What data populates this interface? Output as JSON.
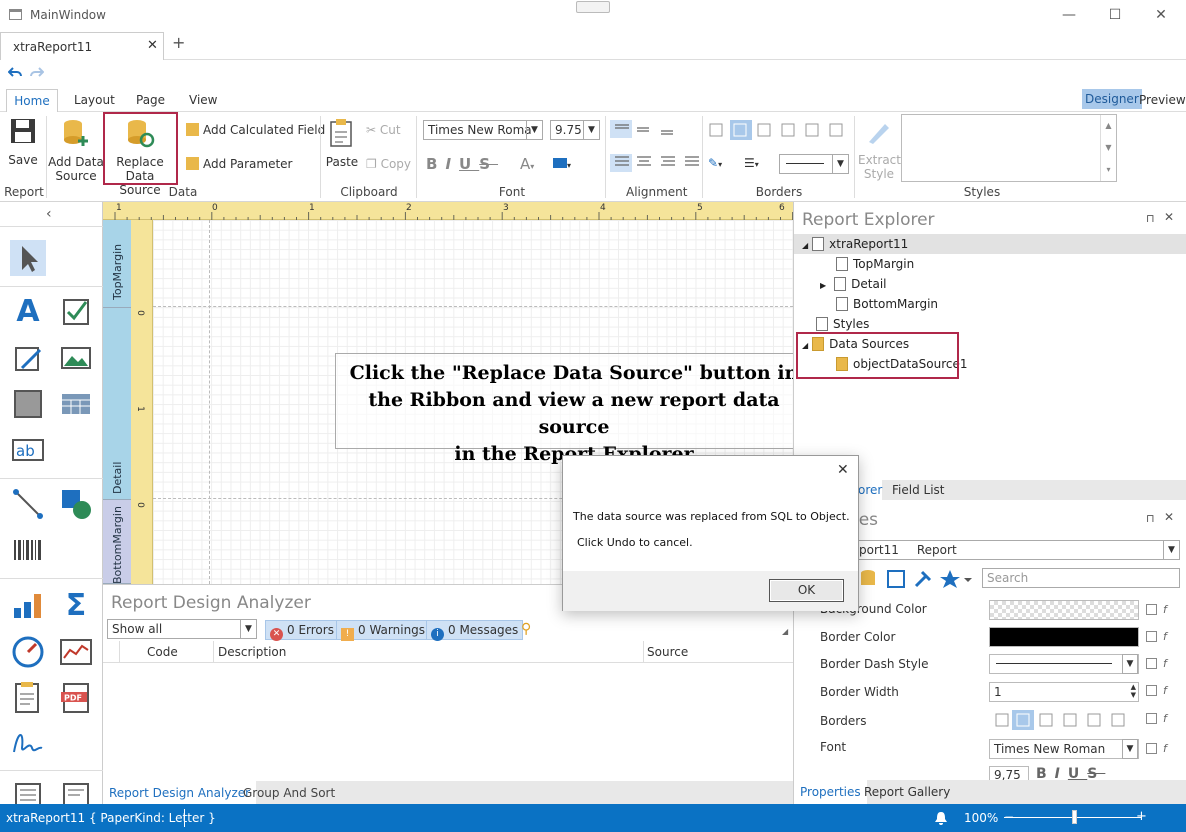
{
  "window": {
    "title": "MainWindow",
    "minimize": "—",
    "maximize": "☐",
    "close": "✕"
  },
  "doc_tab": {
    "label": "xtraReport11",
    "close": "✕",
    "new": "+"
  },
  "ribbon_tabs": [
    {
      "label": "Home"
    },
    {
      "label": "Layout"
    },
    {
      "label": "Page"
    },
    {
      "label": "View"
    }
  ],
  "mode": {
    "designer": "Designer",
    "preview": "Preview"
  },
  "ribbon": {
    "save": "Save",
    "add_data_source_1": "Add Data",
    "add_data_source_2": "Source",
    "replace_1": "Replace",
    "replace_2": "Data Source",
    "add_calc_field": "Add Calculated Field",
    "add_parameter": "Add Parameter",
    "paste": "Paste",
    "cut": "Cut",
    "copy": "Copy",
    "font_name": "Times New Roma",
    "font_size": "9.75",
    "extract_1": "Extract",
    "extract_2": "Style",
    "groups": {
      "report": "Report",
      "data": "Data",
      "clipboard": "Clipboard",
      "font": "Font",
      "alignment": "Alignment",
      "borders": "Borders",
      "styles": "Styles"
    }
  },
  "canvas": {
    "bands": {
      "top": "TopMargin",
      "detail": "Detail",
      "bottom": "BottomMargin"
    },
    "ruler_nums": [
      "1",
      "0",
      "1",
      "2",
      "3",
      "4",
      "5",
      "6"
    ],
    "vruler_nums": [
      "0",
      "1",
      "0"
    ],
    "label_line1": "Click the \"Replace Data Source\" button in",
    "label_line2": "the Ribbon and view a new report data source",
    "label_line3": "in the Report Explorer"
  },
  "analyzer": {
    "title": "Report Design Analyzer",
    "filter": "Show all",
    "errors": "0 Errors",
    "warnings": "0 Warnings",
    "messages": "0 Messages",
    "col_code": "Code",
    "col_desc": "Description",
    "col_source": "Source",
    "tab_analyzer": "Report Design Analyzer",
    "tab_group": "Group And Sort"
  },
  "explorer": {
    "title": "Report Explorer",
    "root": "xtraReport11",
    "top_margin": "TopMargin",
    "detail": "Detail",
    "bottom_margin": "BottomMargin",
    "styles": "Styles",
    "data_sources": "Data Sources",
    "object_ds": "objectDataSource1",
    "tab_explorer": "orer",
    "tab_field_list": "Field List"
  },
  "props": {
    "title": "ies",
    "object_name": "port11",
    "object_type": "Report",
    "search_placeholder": "Search",
    "rows": [
      {
        "name": "Background Color",
        "value": ""
      },
      {
        "name": "Border Color",
        "value": ""
      },
      {
        "name": "Border Dash Style",
        "value": ""
      },
      {
        "name": "Border Width",
        "value": "1"
      },
      {
        "name": "Borders",
        "value": ""
      },
      {
        "name": "Font",
        "value": "Times New Roman"
      }
    ],
    "font_size": "9,75",
    "font_b": "B",
    "font_i": "I",
    "font_u": "U",
    "font_s": "S",
    "tab_properties": "Properties",
    "tab_gallery": "Report Gallery"
  },
  "status": {
    "text": "xtraReport11 { PaperKind: Letter }",
    "zoom": "100%"
  },
  "dialog": {
    "close": "✕",
    "line1": "The data source was replaced from SQL to Object.",
    "line2": "Click Undo to cancel.",
    "ok": "OK"
  },
  "colors": {
    "accent": "#1e6fbf",
    "status": "#0a72c4",
    "highlight": "#b0284a",
    "ruler": "#f5e49a"
  }
}
